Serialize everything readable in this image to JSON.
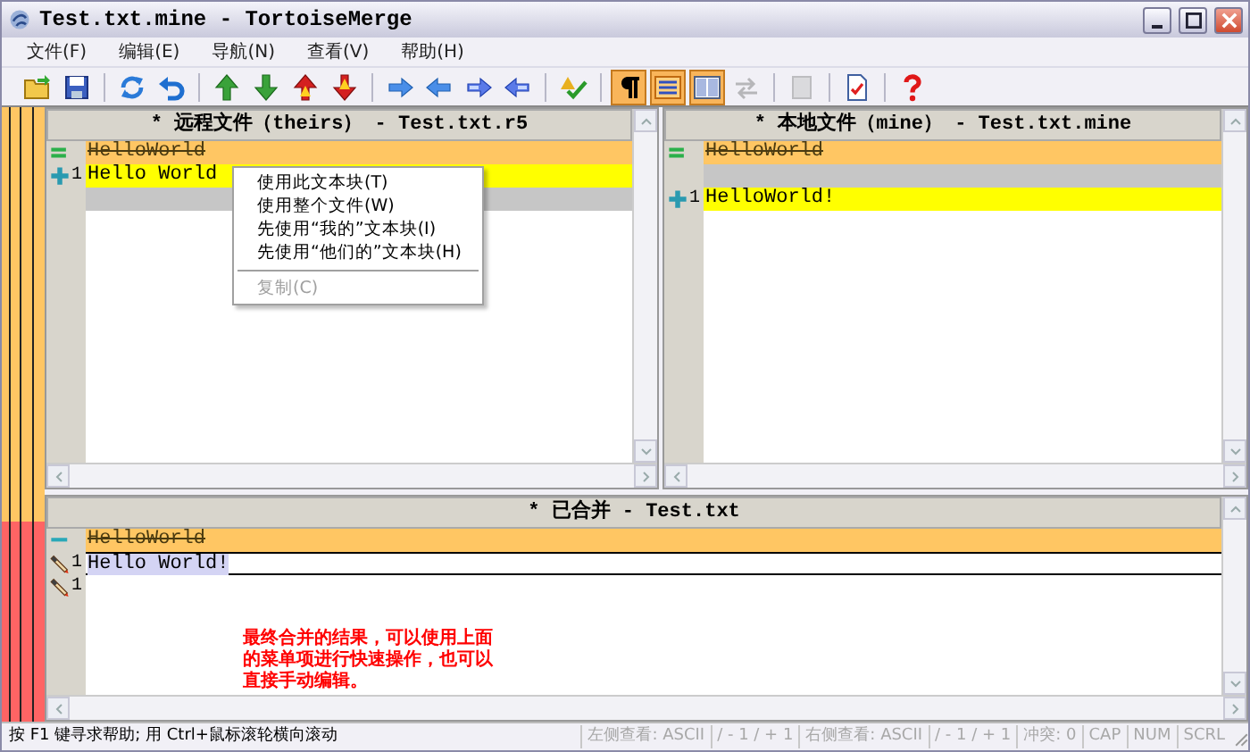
{
  "window": {
    "title": "Test.txt.mine - TortoiseMerge"
  },
  "menu": [
    {
      "label": "文件(F)"
    },
    {
      "label": "编辑(E)"
    },
    {
      "label": "导航(N)"
    },
    {
      "label": "查看(V)"
    },
    {
      "label": "帮助(H)"
    }
  ],
  "toolbar": [
    [
      {
        "kind": "open",
        "on": false,
        "disabled": false
      },
      {
        "kind": "save",
        "on": false,
        "disabled": false
      }
    ],
    [
      {
        "kind": "reload",
        "on": false,
        "disabled": false
      },
      {
        "kind": "undo",
        "on": false,
        "disabled": false
      }
    ],
    [
      {
        "kind": "up-green",
        "on": false,
        "disabled": false
      },
      {
        "kind": "down-green",
        "on": false,
        "disabled": false
      },
      {
        "kind": "up-red",
        "on": false,
        "disabled": false
      },
      {
        "kind": "down-red",
        "on": false,
        "disabled": false
      }
    ],
    [
      {
        "kind": "right",
        "on": false,
        "disabled": false
      },
      {
        "kind": "left",
        "on": false,
        "disabled": false
      },
      {
        "kind": "right-double",
        "on": false,
        "disabled": false
      },
      {
        "kind": "left-double",
        "on": false,
        "disabled": false
      }
    ],
    [
      {
        "kind": "check",
        "on": false,
        "disabled": false
      }
    ],
    [
      {
        "kind": "pilcrow",
        "on": true,
        "disabled": false
      },
      {
        "kind": "lines",
        "on": true,
        "disabled": false
      },
      {
        "kind": "columns",
        "on": true,
        "disabled": false
      },
      {
        "kind": "swap",
        "on": false,
        "disabled": true
      }
    ],
    [
      {
        "kind": "page",
        "on": false,
        "disabled": true
      }
    ],
    [
      {
        "kind": "document",
        "on": false,
        "disabled": false
      }
    ],
    [
      {
        "kind": "help",
        "on": false,
        "disabled": false
      }
    ]
  ],
  "panes": [
    {
      "title": "* 远程文件（theirs） - Test.txt.r5",
      "lines": [
        {
          "kind": "removed",
          "marker": {
            "kind": "equal"
          },
          "text": "HelloWorld"
        },
        {
          "kind": "added",
          "marker": {
            "kind": "plus"
          },
          "number": "1",
          "text": "Hello World"
        },
        {
          "kind": "blank"
        }
      ]
    },
    {
      "title": "* 本地文件（mine） - Test.txt.mine",
      "lines": [
        {
          "kind": "removed",
          "marker": {
            "kind": "equal"
          },
          "text": "HelloWorld"
        },
        {
          "kind": "blank"
        },
        {
          "kind": "added",
          "marker": {
            "kind": "plus"
          },
          "number": "1",
          "text": "HelloWorld!"
        }
      ]
    }
  ],
  "merged_pane": {
    "title": "* 已合并 - Test.txt",
    "lines": [
      {
        "kind": "removed",
        "marker": {
          "kind": "minus"
        },
        "text": "HelloWorld"
      },
      {
        "kind": "edited",
        "marker": {
          "kind": "pencil"
        },
        "number": "1",
        "text": "Hello World!"
      },
      {
        "kind": "empty",
        "marker": {
          "kind": "pencil"
        },
        "number": "1"
      }
    ],
    "note": "最终合并的结果，可以使用上面的菜单项进行快速操作，也可以直接手动编辑。"
  },
  "context_menu": {
    "items": [
      {
        "label": "使用此文本块(T)",
        "disabled": false
      },
      {
        "label": "使用整个文件(W)",
        "disabled": false
      },
      {
        "label": "先使用“我的”文本块(I)",
        "disabled": false
      },
      {
        "label": "先使用“他们的”文本块(H)",
        "disabled": false
      },
      {
        "kind": "separator"
      },
      {
        "label": "复制(C)",
        "disabled": true
      }
    ]
  },
  "status_bar": {
    "help": "按 F1 键寻求帮助; 用 Ctrl+鼠标滚轮横向滚动",
    "fields": [
      {
        "text": "左侧查看: ASCII",
        "disabled": true
      },
      {
        "text": "/ - 1 / + 1",
        "disabled": true
      },
      {
        "text": "右侧查看: ASCII",
        "disabled": true
      },
      {
        "text": "/ - 1 / + 1",
        "disabled": true
      },
      {
        "text": "冲突: 0",
        "disabled": true
      },
      {
        "text": "CAP",
        "disabled": true
      },
      {
        "text": "NUM",
        "disabled": true
      },
      {
        "text": "SCRL",
        "disabled": true
      }
    ]
  }
}
